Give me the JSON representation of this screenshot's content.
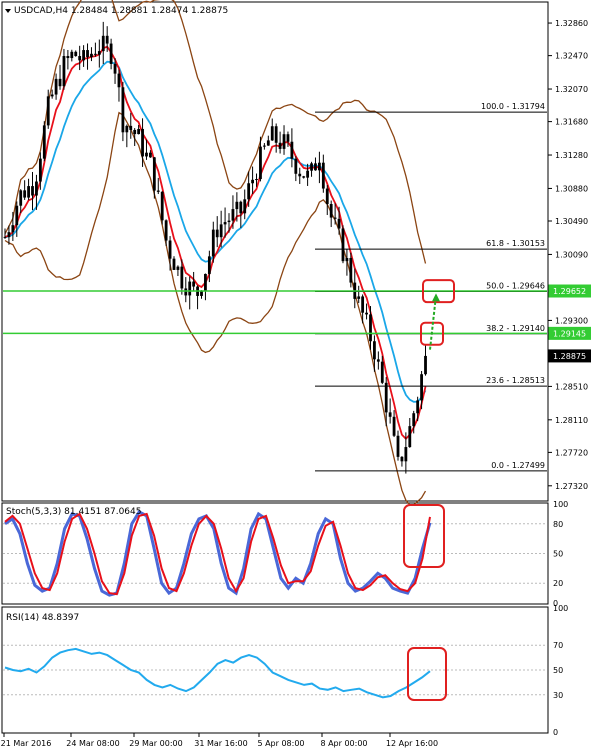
{
  "header": {
    "symbol_text": "USDCAD,H4  1.28484 1.28881 1.28474 1.28875"
  },
  "price_axis": {
    "ticks": [
      "1.32860",
      "1.32470",
      "1.32070",
      "1.31680",
      "1.31280",
      "1.30880",
      "1.30490",
      "1.30090",
      "1.29300",
      "1.28510",
      "1.28110",
      "1.27720",
      "1.27320"
    ],
    "current_price": "1.28875",
    "green_level_1": "1.29652",
    "green_level_2": "1.29145"
  },
  "fib_labels": {
    "f100": "100.0 - 1.31794",
    "f618": "61.8 - 1.30153",
    "f500": "50.0 - 1.29646",
    "f382": "38.2 - 1.29140",
    "f236": "23.6 - 1.28513",
    "f000": "0.0 - 1.27499"
  },
  "stoch": {
    "title": "Stoch(5,3,3) 81.4151 87.0645",
    "ticks": [
      "100",
      "80",
      "50",
      "20",
      "0"
    ]
  },
  "rsi": {
    "title": "RSI(14) 48.8397",
    "ticks": [
      "100",
      "70",
      "50",
      "30",
      "0"
    ]
  },
  "time_axis": {
    "labels": [
      "21 Mar 2016",
      "24 Mar 08:00",
      "29 Mar 00:00",
      "31 Mar 16:00",
      "5 Apr 08:00",
      "8 Apr 00:00",
      "12 Apr 16:00"
    ]
  },
  "colors": {
    "ema_fast": "#e8101a",
    "ema_slow": "#1aa7e8",
    "bollinger": "#8b4513",
    "fib": "#000000",
    "green_line": "#33cc33",
    "highlight": "#e02020",
    "stoch_main": "#4a68d8",
    "stoch_signal": "#e8101a",
    "rsi_line": "#22aaee",
    "price_box": "#000000"
  },
  "chart_data": [
    {
      "type": "candlestick",
      "title": "USDCAD,H4",
      "ylim": [
        1.2715,
        1.331
      ],
      "price_path_approx": [
        [
          0,
          1.303
        ],
        [
          15,
          1.308
        ],
        [
          30,
          1.3095
        ],
        [
          45,
          1.319
        ],
        [
          60,
          1.3235
        ],
        [
          70,
          1.325
        ],
        [
          80,
          1.324
        ],
        [
          95,
          1.326
        ],
        [
          110,
          1.325
        ],
        [
          120,
          1.317
        ],
        [
          135,
          1.315
        ],
        [
          150,
          1.311
        ],
        [
          165,
          1.302
        ],
        [
          180,
          1.298
        ],
        [
          195,
          1.296
        ],
        [
          205,
          1.2995
        ],
        [
          215,
          1.304
        ],
        [
          225,
          1.305
        ],
        [
          240,
          1.306
        ],
        [
          255,
          1.311
        ],
        [
          270,
          1.315
        ],
        [
          285,
          1.314
        ],
        [
          300,
          1.311
        ],
        [
          310,
          1.31
        ],
        [
          320,
          1.313
        ],
        [
          330,
          1.306
        ],
        [
          345,
          1.301
        ],
        [
          360,
          1.295
        ],
        [
          375,
          1.29
        ],
        [
          390,
          1.282
        ],
        [
          400,
          1.2755
        ],
        [
          410,
          1.279
        ],
        [
          420,
          1.284
        ],
        [
          428,
          1.2887
        ]
      ],
      "fibonacci": [
        {
          "level": 100.0,
          "price": 1.31794
        },
        {
          "level": 61.8,
          "price": 1.30153
        },
        {
          "level": 50.0,
          "price": 1.29646
        },
        {
          "level": 38.2,
          "price": 1.2914
        },
        {
          "level": 23.6,
          "price": 1.28513
        },
        {
          "level": 0.0,
          "price": 1.27499
        }
      ],
      "horizontal_lines": [
        1.29652,
        1.29145
      ],
      "current_price": 1.28875
    },
    {
      "type": "line",
      "title": "Stoch(5,3,3) 81.4151 87.0645",
      "ylim": [
        0,
        100
      ],
      "series": [
        {
          "values_approx": [
            80,
            85,
            70,
            40,
            18,
            12,
            15,
            40,
            75,
            90,
            88,
            65,
            35,
            12,
            8,
            10,
            40,
            80,
            92,
            88,
            55,
            20,
            10,
            15,
            40,
            70,
            85,
            88,
            75,
            40,
            15,
            10,
            35,
            75,
            90,
            85,
            55,
            25,
            15,
            25,
            20,
            40,
            70,
            85,
            80,
            45,
            20,
            12,
            15,
            22,
            30,
            25,
            15,
            12,
            10,
            25,
            55,
            81
          ]
        },
        {
          "values_approx": [
            82,
            88,
            80,
            55,
            30,
            15,
            13,
            30,
            62,
            85,
            90,
            75,
            50,
            22,
            10,
            9,
            30,
            68,
            88,
            90,
            68,
            35,
            15,
            12,
            30,
            58,
            80,
            88,
            80,
            55,
            25,
            12,
            25,
            62,
            85,
            88,
            65,
            38,
            20,
            22,
            22,
            32,
            58,
            78,
            82,
            58,
            30,
            15,
            13,
            18,
            26,
            28,
            20,
            14,
            12,
            20,
            45,
            87
          ]
        }
      ]
    },
    {
      "type": "line",
      "title": "RSI(14) 48.8397",
      "ylim": [
        0,
        100
      ],
      "series": [
        {
          "values_approx": [
            52,
            50,
            49,
            51,
            48,
            53,
            60,
            64,
            66,
            67,
            65,
            63,
            64,
            62,
            58,
            54,
            50,
            48,
            42,
            38,
            36,
            38,
            35,
            33,
            36,
            42,
            48,
            55,
            58,
            56,
            60,
            62,
            60,
            55,
            48,
            45,
            42,
            40,
            38,
            39,
            35,
            34,
            36,
            33,
            34,
            35,
            32,
            30,
            28,
            29,
            33,
            36,
            40,
            44,
            49
          ]
        }
      ]
    }
  ]
}
